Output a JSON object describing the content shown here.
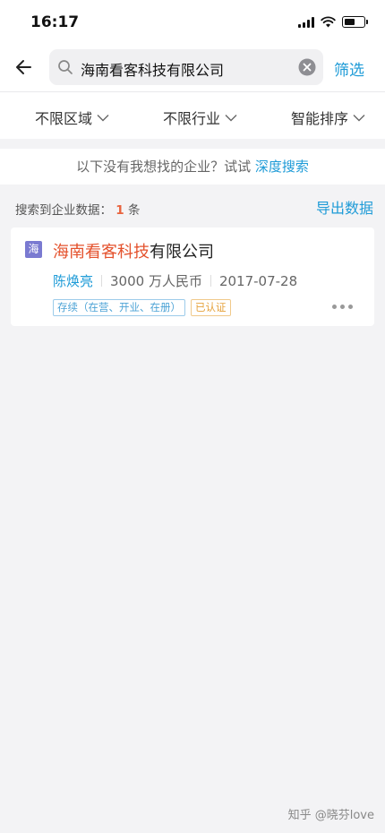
{
  "status_bar": {
    "time": "16:17",
    "battery_level": 0.6
  },
  "search": {
    "query": "海南看客科技有限公司",
    "filter_label": "筛选"
  },
  "filters": [
    {
      "label": "不限区域"
    },
    {
      "label": "不限行业"
    },
    {
      "label": "智能排序"
    }
  ],
  "deep_search": {
    "prompt": "以下没有我想找的企业？试试",
    "link": "深度搜索"
  },
  "summary": {
    "prefix": "搜索到企业数据：",
    "count": "1",
    "suffix": "条",
    "export_label": "导出数据"
  },
  "result": {
    "avatar": "海",
    "name_highlight": "海南看客科技",
    "name_rest": "有限公司",
    "legal_person": "陈焕亮",
    "capital": "3000 万人民币",
    "date": "2017-07-28",
    "status_tag": "存续（在营、开业、在册）",
    "cert_tag": "已认证"
  },
  "watermark": "知乎 @晓芬love",
  "colors": {
    "accent": "#1e9bd7",
    "highlight": "#e4522d",
    "count": "#e8633e",
    "cert": "#e6a23c",
    "avatar_bg": "#7a7ad1"
  }
}
